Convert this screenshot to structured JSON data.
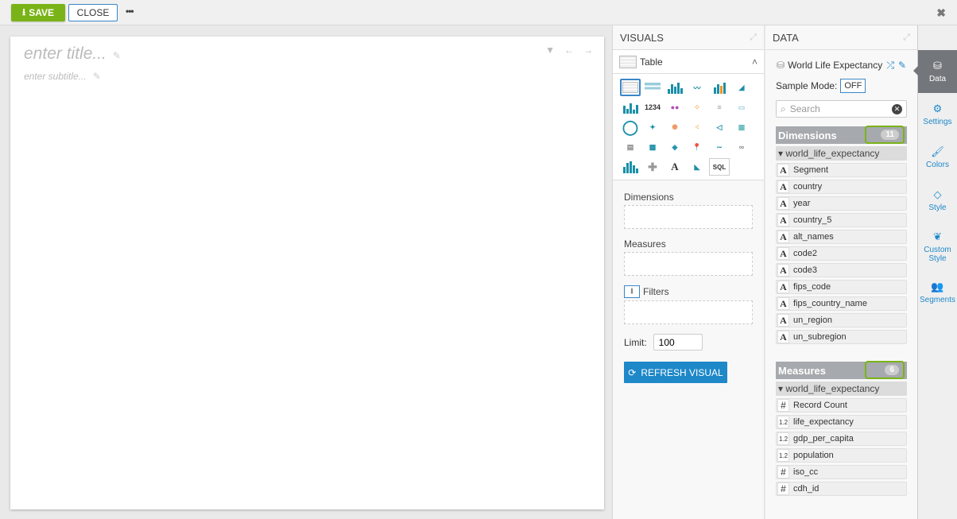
{
  "toolbar": {
    "save_label": "SAVE",
    "close_label": "CLOSE",
    "more_label": "•••",
    "close_window": "✖"
  },
  "canvas": {
    "title_placeholder": "enter title...",
    "subtitle_placeholder": "enter subtitle..."
  },
  "visuals": {
    "header": "VISUALS",
    "selected_type": "Table",
    "shelves": {
      "dimensions": "Dimensions",
      "measures": "Measures",
      "filters": "Filters",
      "limit_label": "Limit:",
      "limit_value": "100"
    },
    "refresh_label": "REFRESH VISUAL"
  },
  "data": {
    "header": "DATA",
    "dataset": "World Life Expectancy",
    "sample_mode_label": "Sample Mode:",
    "sample_mode_value": "OFF",
    "search_placeholder": "Search",
    "dimensions": {
      "label": "Dimensions",
      "count": "11",
      "group": "world_life_expectancy",
      "fields": [
        "Segment",
        "country",
        "year",
        "country_5",
        "alt_names",
        "code2",
        "code3",
        "fips_code",
        "fips_country_name",
        "un_region",
        "un_subregion"
      ]
    },
    "measures": {
      "label": "Measures",
      "count": "6",
      "group": "world_life_expectancy",
      "fields": [
        {
          "type": "#",
          "name": "Record Count"
        },
        {
          "type": "1.2",
          "name": "life_expectancy"
        },
        {
          "type": "1.2",
          "name": "gdp_per_capita"
        },
        {
          "type": "1.2",
          "name": "population"
        },
        {
          "type": "#",
          "name": "iso_cc"
        },
        {
          "type": "#",
          "name": "cdh_id"
        }
      ]
    }
  },
  "sidebar": {
    "items": [
      {
        "label": "Data",
        "icon": "cubes-icon"
      },
      {
        "label": "Settings",
        "icon": "gears-icon"
      },
      {
        "label": "Colors",
        "icon": "brush-icon"
      },
      {
        "label": "Style",
        "icon": "diamond-icon"
      },
      {
        "label": "Custom Style",
        "icon": "leaf-icon"
      },
      {
        "label": "Segments",
        "icon": "users-icon"
      }
    ]
  }
}
